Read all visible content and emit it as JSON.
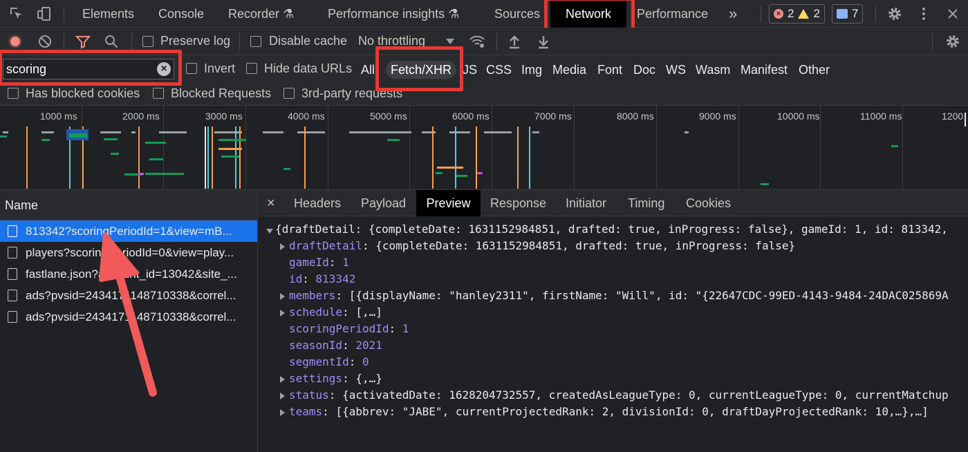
{
  "tabs": {
    "elements": "Elements",
    "console": "Console",
    "recorder": "Recorder",
    "performance_insights": "Performance insights",
    "sources": "Sources",
    "network": "Network",
    "performance": "Performance",
    "more": "»"
  },
  "counts": {
    "errors": "2",
    "warnings": "2",
    "messages": "7"
  },
  "toolbar": {
    "preserve_log": "Preserve log",
    "disable_cache": "Disable cache",
    "throttling": "No throttling"
  },
  "filter": {
    "value": "scoring",
    "invert": "Invert",
    "hide_data_urls": "Hide data URLs",
    "types": [
      "All",
      "Fetch/XHR",
      "JS",
      "CSS",
      "Img",
      "Media",
      "Font",
      "Doc",
      "WS",
      "Wasm",
      "Manifest",
      "Other"
    ],
    "has_blocked_cookies": "Has blocked cookies",
    "blocked_requests": "Blocked Requests",
    "third_party": "3rd-party requests"
  },
  "timeline": {
    "ticks": [
      "1000 ms",
      "2000 ms",
      "3000 ms",
      "4000 ms",
      "5000 ms",
      "6000 ms",
      "7000 ms",
      "8000 ms",
      "9000 ms",
      "10000 ms",
      "11000 ms",
      "1200"
    ]
  },
  "requests": {
    "header": "Name",
    "items": [
      "813342?scoringPeriodId=1&view=mB...",
      "players?scoringPeriodId=0&view=play...",
      "fastlane.json?account_id=13042&site_...",
      "ads?pvsid=2434171148710338&correl...",
      "ads?pvsid=2434171148710338&correl..."
    ]
  },
  "detail_tabs": {
    "close": "×",
    "headers": "Headers",
    "payload": "Payload",
    "preview": "Preview",
    "response": "Response",
    "initiator": "Initiator",
    "timing": "Timing",
    "cookies": "Cookies"
  },
  "preview": {
    "root": "{draftDetail: {completeDate: 1631152984851, drafted: true, inProgress: false}, gameId: 1, id: 813342,",
    "lines": [
      {
        "key": "draftDetail",
        "value": "{completeDate: 1631152984851, drafted: true, inProgress: false}"
      },
      {
        "key": "gameId",
        "value": "1"
      },
      {
        "key": "id",
        "value": "813342"
      },
      {
        "key": "members",
        "value": "[{displayName: \"hanley2311\", firstName: \"Will\", id: \"{22647CDC-99ED-4143-9484-24DAC025869A"
      },
      {
        "key": "schedule",
        "value": "[,…]"
      },
      {
        "key": "scoringPeriodId",
        "value": "1"
      },
      {
        "key": "seasonId",
        "value": "2021"
      },
      {
        "key": "segmentId",
        "value": "0"
      },
      {
        "key": "settings",
        "value": "{,…}"
      },
      {
        "key": "status",
        "value": "{activatedDate: 1628204732557, createdAsLeagueType: 0, currentLeagueType: 0, currentMatchup"
      },
      {
        "key": "teams",
        "value": "[{abbrev: \"JABE\", currentProjectedRank: 2, divisionId: 0, draftDayProjectedRank: 10,…},…]"
      }
    ]
  },
  "colors": {
    "highlight": "#e53935",
    "selection": "#1a73e8",
    "arrow": "#f05a5a"
  }
}
